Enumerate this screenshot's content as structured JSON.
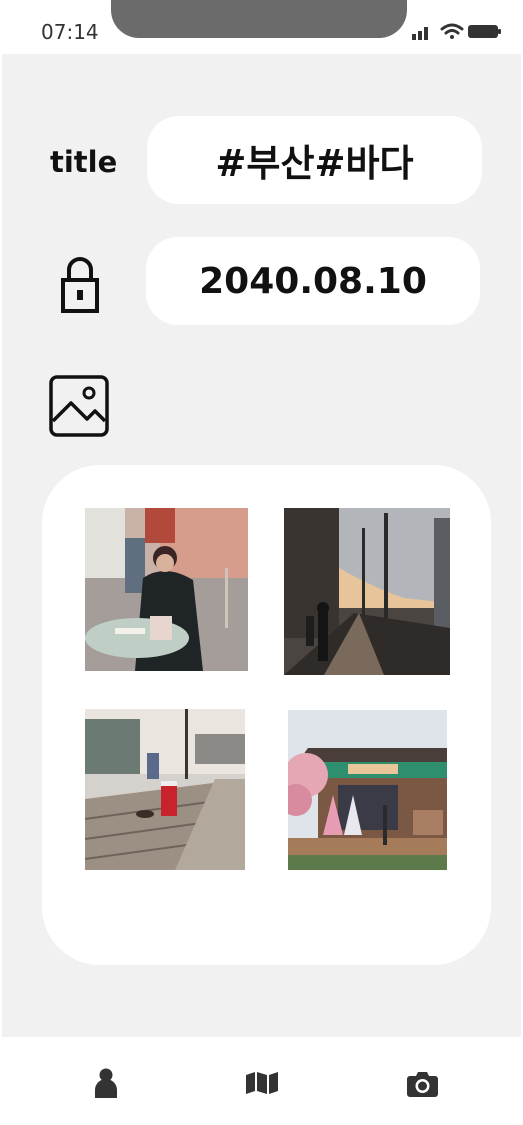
{
  "status_bar": {
    "time": "07:14",
    "icons": [
      "signal-icon",
      "wifi-icon",
      "battery-icon"
    ]
  },
  "form": {
    "title_label": "title",
    "title_value": "#부산#바다",
    "date_value": "2040.08.10",
    "lock_icon": "lock-icon",
    "image_icon": "image-icon"
  },
  "gallery": {
    "photos": [
      {
        "subject": "woman-at-cafe-table-photo"
      },
      {
        "subject": "sunset-street-photo"
      },
      {
        "subject": "coffee-cup-on-deck-photo"
      },
      {
        "subject": "hanok-shop-storefront-photo"
      }
    ]
  },
  "bottom_nav": {
    "items": [
      {
        "icon": "person-icon"
      },
      {
        "icon": "map-icon"
      },
      {
        "icon": "camera-icon"
      }
    ]
  },
  "colors": {
    "background": "#f1f1f1",
    "card": "#ffffff",
    "text": "#111111",
    "nav_icon": "#333333"
  }
}
